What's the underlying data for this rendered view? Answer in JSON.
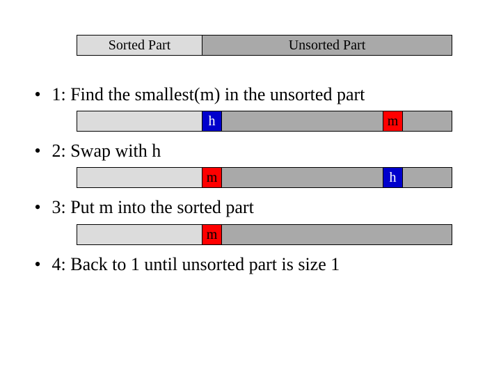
{
  "legend": {
    "sorted_label": "Sorted Part",
    "unsorted_label": "Unsorted Part"
  },
  "steps": {
    "s1": "1: Find the smallest(m) in the unsorted part",
    "s2": "2: Swap with h",
    "s3": "3: Put m into the sorted part",
    "s4": "4: Back to 1 until unsorted part is size 1"
  },
  "cells": {
    "h": "h",
    "m": "m"
  },
  "bullet": "•"
}
